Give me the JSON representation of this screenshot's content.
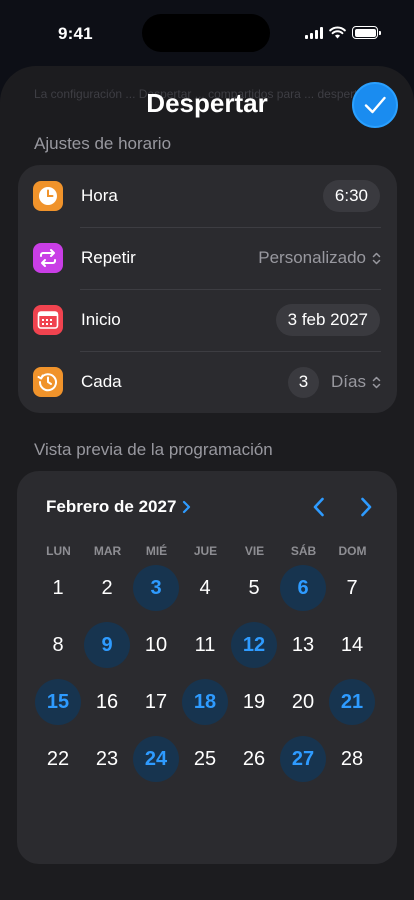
{
  "status_bar": {
    "time": "9:41"
  },
  "sheet": {
    "behind_text": "La configuración ... Despertar ... compartidos para ... despertar.",
    "title": "Despertar",
    "confirm_icon": "checkmark-icon"
  },
  "schedule_section": {
    "header": "Ajustes de horario",
    "rows": [
      {
        "label": "Hora",
        "value": "6:30",
        "icon": "clock-icon",
        "color": "#f0932b"
      },
      {
        "label": "Repetir",
        "value": "Personalizado",
        "icon": "repeat-icon",
        "color": "#c93ee6"
      },
      {
        "label": "Inicio",
        "value": "3 feb 2027",
        "icon": "calendar-icon",
        "color": "#f0434f"
      },
      {
        "label": "Cada",
        "number": "3",
        "unit": "Días",
        "icon": "history-icon",
        "color": "#f0932b"
      }
    ]
  },
  "preview_section": {
    "header": "Vista previa de la programación"
  },
  "calendar": {
    "month_label": "Febrero de 2027",
    "weekdays": [
      "LUN",
      "MAR",
      "MIÉ",
      "JUE",
      "VIE",
      "SÁB",
      "DOM"
    ],
    "weeks": [
      [
        "1",
        "2",
        "3",
        "4",
        "5",
        "6",
        "7"
      ],
      [
        "8",
        "9",
        "10",
        "11",
        "12",
        "13",
        "14"
      ],
      [
        "15",
        "16",
        "17",
        "18",
        "19",
        "20",
        "21"
      ],
      [
        "22",
        "23",
        "24",
        "25",
        "26",
        "27",
        "28"
      ]
    ],
    "selected_days": [
      "3",
      "6",
      "9",
      "12",
      "15",
      "18",
      "21",
      "24",
      "27"
    ],
    "accent_color": "#2e9bff"
  }
}
